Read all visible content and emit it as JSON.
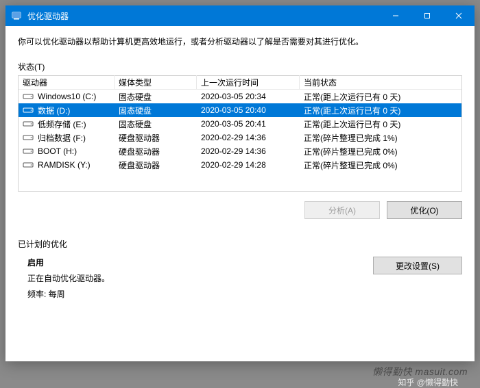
{
  "window": {
    "title": "优化驱动器"
  },
  "description": "你可以优化驱动器以帮助计算机更高效地运行，或者分析驱动器以了解是否需要对其进行优化。",
  "status_label": "状态(T)",
  "columns": {
    "drive": "驱动器",
    "media": "媒体类型",
    "last": "上一次运行时间",
    "state": "当前状态"
  },
  "drives": [
    {
      "name": "Windows10 (C:)",
      "media": "固态硬盘",
      "last": "2020-03-05 20:34",
      "state": "正常(距上次运行已有 0 天)",
      "selected": false
    },
    {
      "name": "数据 (D:)",
      "media": "固态硬盘",
      "last": "2020-03-05 20:40",
      "state": "正常(距上次运行已有 0 天)",
      "selected": true
    },
    {
      "name": "低频存储 (E:)",
      "media": "固态硬盘",
      "last": "2020-03-05 20:41",
      "state": "正常(距上次运行已有 0 天)",
      "selected": false
    },
    {
      "name": "归档数据 (F:)",
      "media": "硬盘驱动器",
      "last": "2020-02-29 14:36",
      "state": "正常(碎片整理已完成 1%)",
      "selected": false
    },
    {
      "name": "BOOT (H:)",
      "media": "硬盘驱动器",
      "last": "2020-02-29 14:36",
      "state": "正常(碎片整理已完成 0%)",
      "selected": false
    },
    {
      "name": "RAMDISK (Y:)",
      "media": "硬盘驱动器",
      "last": "2020-02-29 14:28",
      "state": "正常(碎片整理已完成 0%)",
      "selected": false
    }
  ],
  "buttons": {
    "analyze": "分析(A)",
    "optimize": "优化(O)",
    "change_settings": "更改设置(S)"
  },
  "schedule": {
    "heading": "已计划的优化",
    "enabled_label": "启用",
    "state_line": "正在自动优化驱动器。",
    "freq_line": "频率: 每周"
  },
  "watermark": "懒得勤快  masuit.com",
  "watermark2": "知乎 @懒得勤快"
}
